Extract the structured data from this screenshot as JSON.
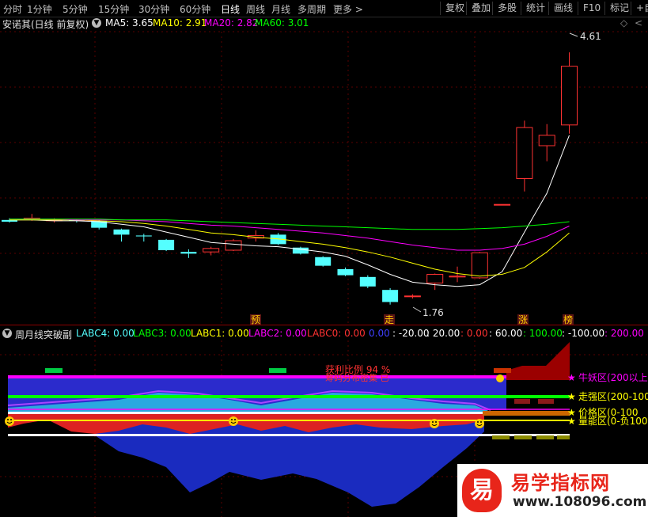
{
  "toolbar": {
    "left_items": [
      "分时",
      "1分钟",
      "5分钟",
      "15分钟",
      "30分钟",
      "60分钟",
      "日线",
      "周线",
      "月线",
      "多周期",
      "更多 >"
    ],
    "active": "日线",
    "right_items": [
      "复权",
      "叠加",
      "多股",
      "统计",
      "画线",
      "F10",
      "标记",
      "+自"
    ]
  },
  "main_legend": {
    "name": "安诺其(日线 前复权)",
    "ma5": "MA5: 3.65",
    "ma10": "MA10: 2.91",
    "ma20": "MA20: 2.82",
    "ma60": "MA60: 3.01"
  },
  "sub_legend": {
    "name": "周月线突破副",
    "labc4": "LABC4: 0.00",
    "labc3": "LABC3: 0.00",
    "labc1": "LABC1: 0.00",
    "labc2": "LABC2: 0.00",
    "labc0": "LABC0: 0.00",
    "v1": "0.00",
    "v2": ": -20.00",
    "v3": ": 20.00",
    "v4": ": 0.00",
    "v5": ": 60.00",
    "v6": ": 100.00",
    "v7": ": -100.00",
    "v8": ": 200.00"
  },
  "colors": {
    "up": "#ff3232",
    "down": "#54ffff",
    "ma5": "#ffffff",
    "ma10": "#ffff00",
    "ma20": "#ff00ff",
    "ma60": "#00ff00"
  },
  "price_labels": {
    "high": "4.61",
    "low": "1.76"
  },
  "badges": [
    "预",
    "走",
    "涨",
    "榜"
  ],
  "zones": [
    "牛妖区(200以上",
    "走强区(200-100",
    "价格区(0-100",
    "量能区(0-负100"
  ],
  "sub_texts": {
    "t1": "获利比例 94 %",
    "t2": "筹码分布密集 已"
  },
  "watermark": {
    "title": "易学指标网",
    "url": "www.108096.com",
    "logo": "易"
  },
  "chart_data": {
    "type": "candlestick",
    "price_range": [
      1.55,
      4.85
    ],
    "candles": [
      {
        "o": 2.67,
        "h": 2.69,
        "l": 2.64,
        "c": 2.65
      },
      {
        "o": 2.68,
        "h": 2.74,
        "l": 2.66,
        "c": 2.69
      },
      {
        "o": 2.67,
        "h": 2.69,
        "l": 2.64,
        "c": 2.67
      },
      {
        "o": 2.67,
        "h": 2.68,
        "l": 2.64,
        "c": 2.66
      },
      {
        "o": 2.66,
        "h": 2.67,
        "l": 2.56,
        "c": 2.58
      },
      {
        "o": 2.56,
        "h": 2.57,
        "l": 2.42,
        "c": 2.5
      },
      {
        "o": 2.49,
        "h": 2.51,
        "l": 2.42,
        "c": 2.48
      },
      {
        "o": 2.44,
        "h": 2.45,
        "l": 2.31,
        "c": 2.32
      },
      {
        "o": 2.3,
        "h": 2.33,
        "l": 2.23,
        "c": 2.28
      },
      {
        "o": 2.3,
        "h": 2.36,
        "l": 2.26,
        "c": 2.34
      },
      {
        "o": 2.32,
        "h": 2.45,
        "l": 2.31,
        "c": 2.43
      },
      {
        "o": 2.46,
        "h": 2.55,
        "l": 2.42,
        "c": 2.49
      },
      {
        "o": 2.5,
        "h": 2.52,
        "l": 2.38,
        "c": 2.39
      },
      {
        "o": 2.35,
        "h": 2.36,
        "l": 2.27,
        "c": 2.28
      },
      {
        "o": 2.24,
        "h": 2.25,
        "l": 2.13,
        "c": 2.14
      },
      {
        "o": 2.1,
        "h": 2.12,
        "l": 2.02,
        "c": 2.03
      },
      {
        "o": 2.01,
        "h": 2.03,
        "l": 1.88,
        "c": 1.9
      },
      {
        "o": 1.86,
        "h": 1.88,
        "l": 1.69,
        "c": 1.72
      },
      {
        "o": 1.79,
        "h": 1.81,
        "l": 1.76,
        "c": 1.79
      },
      {
        "o": 1.94,
        "h": 2.05,
        "l": 1.86,
        "c": 2.04
      },
      {
        "o": 2.01,
        "h": 2.13,
        "l": 1.95,
        "c": 2.02
      },
      {
        "o": 2.0,
        "h": 2.3,
        "l": 1.99,
        "c": 2.29
      },
      {
        "o": 2.85,
        "h": 2.85,
        "l": 2.84,
        "c": 2.85
      },
      {
        "o": 3.15,
        "h": 3.82,
        "l": 3.0,
        "c": 3.74
      },
      {
        "o": 3.53,
        "h": 3.78,
        "l": 3.35,
        "c": 3.65
      },
      {
        "o": 3.77,
        "h": 4.61,
        "l": 3.67,
        "c": 4.45
      }
    ],
    "ma5": [
      2.67,
      2.67,
      2.66,
      2.66,
      2.65,
      2.62,
      2.59,
      2.53,
      2.47,
      2.41,
      2.39,
      2.37,
      2.36,
      2.33,
      2.3,
      2.25,
      2.15,
      2.04,
      1.95,
      1.92,
      1.9,
      1.92,
      2.07,
      2.53,
      2.98,
      3.65
    ],
    "ma10": [
      2.67,
      2.67,
      2.67,
      2.67,
      2.66,
      2.65,
      2.63,
      2.6,
      2.56,
      2.52,
      2.5,
      2.47,
      2.45,
      2.42,
      2.39,
      2.35,
      2.3,
      2.24,
      2.17,
      2.1,
      2.05,
      2.02,
      2.04,
      2.12,
      2.3,
      2.52
    ],
    "ma20": [
      2.68,
      2.68,
      2.68,
      2.67,
      2.67,
      2.67,
      2.66,
      2.65,
      2.63,
      2.61,
      2.6,
      2.58,
      2.56,
      2.54,
      2.52,
      2.49,
      2.46,
      2.42,
      2.38,
      2.35,
      2.32,
      2.32,
      2.34,
      2.39,
      2.48,
      2.6
    ],
    "ma60": [
      2.68,
      2.68,
      2.68,
      2.68,
      2.68,
      2.67,
      2.67,
      2.67,
      2.66,
      2.65,
      2.64,
      2.63,
      2.62,
      2.61,
      2.6,
      2.59,
      2.58,
      2.57,
      2.56,
      2.56,
      2.56,
      2.57,
      2.58,
      2.6,
      2.62,
      2.65
    ]
  }
}
